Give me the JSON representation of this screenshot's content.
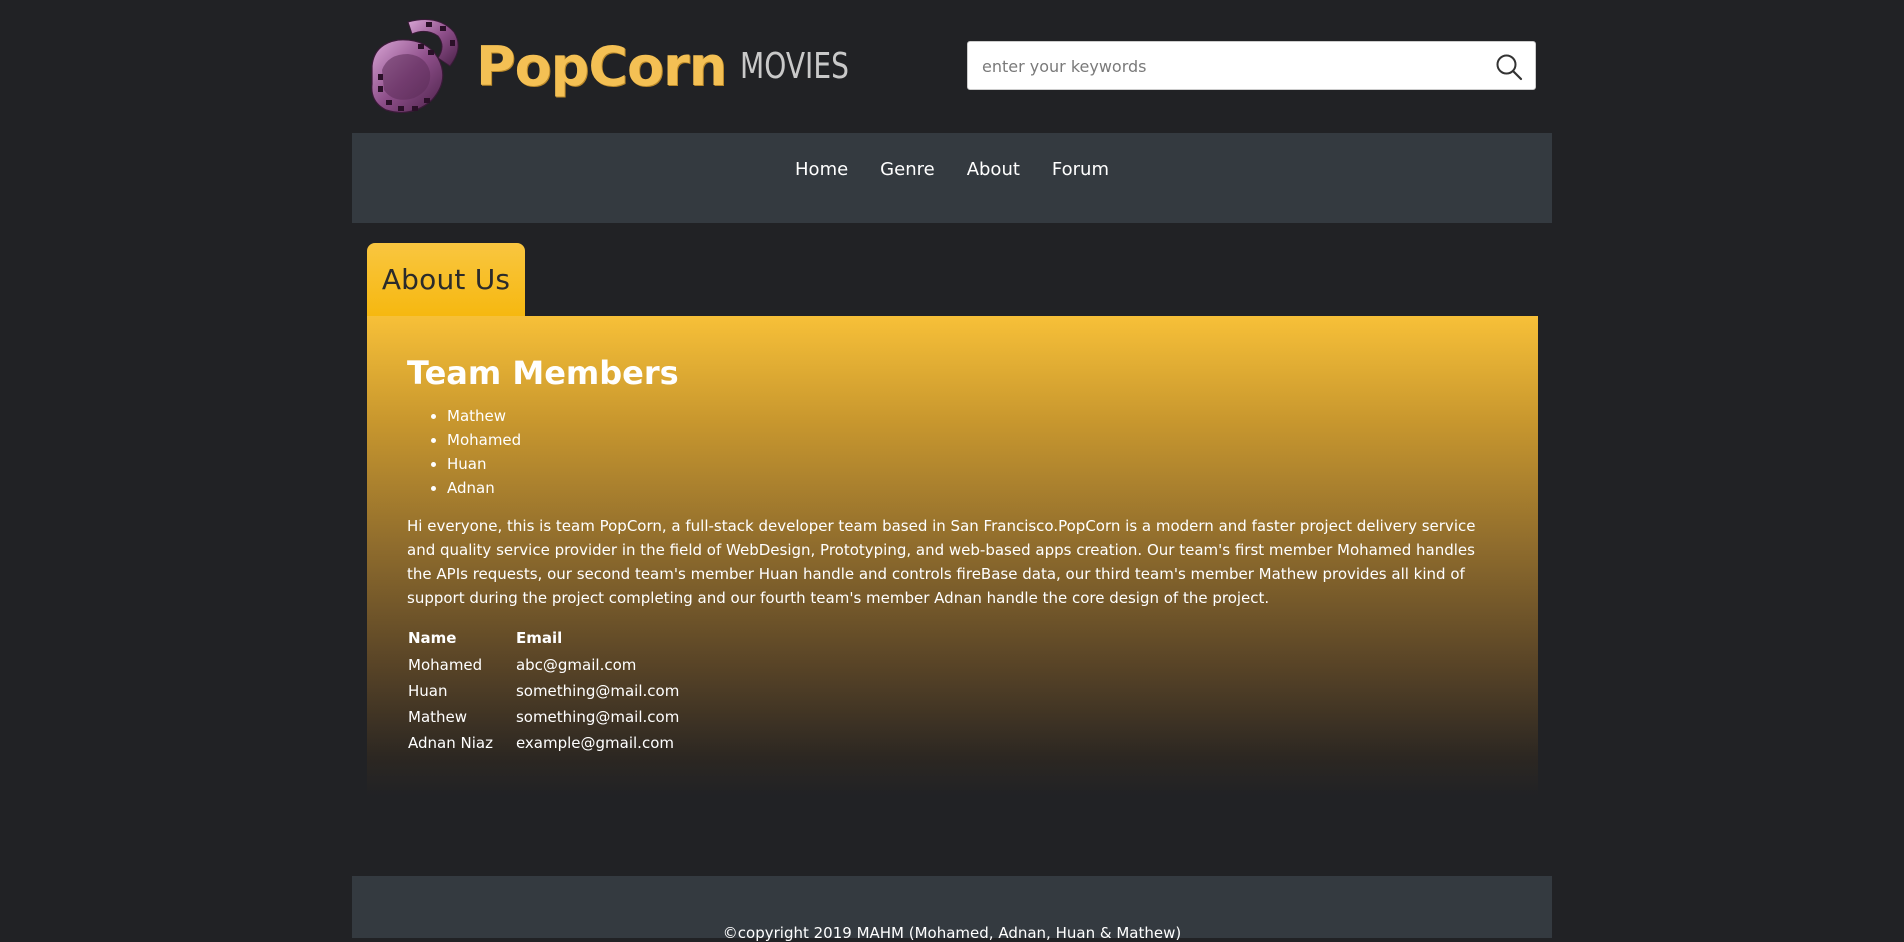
{
  "header": {
    "logo_primary": "PopCorn",
    "logo_secondary": "MOVIES",
    "search_placeholder": "enter your keywords",
    "search_icon": "search-icon"
  },
  "nav": {
    "items": [
      {
        "label": "Home"
      },
      {
        "label": "Genre"
      },
      {
        "label": "About"
      },
      {
        "label": "Forum"
      }
    ]
  },
  "about": {
    "tab_label": "About Us",
    "title": "Team Members",
    "members": [
      "Mathew",
      "Mohamed",
      "Huan",
      "Adnan"
    ],
    "description": "Hi everyone, this is team PopCorn, a full-stack developer team based in San Francisco.PopCorn is a modern and faster project delivery service and quality service provider in the field of WebDesign, Prototyping, and web-based apps creation. Our team's first member Mohamed handles the APIs requests, our second team's member Huan handle and controls fireBase data, our third team's member Mathew provides all kind of support during the project completing and our fourth team's member Adnan handle the core design of the project.",
    "table": {
      "headers": [
        "Name",
        "Email"
      ],
      "rows": [
        [
          "Mohamed",
          "abc@gmail.com"
        ],
        [
          "Huan",
          "something@mail.com"
        ],
        [
          "Mathew",
          "something@mail.com"
        ],
        [
          "Adnan Niaz",
          "example@gmail.com"
        ]
      ]
    }
  },
  "footer": {
    "copyright": "©copyright 2019 MAHM (Mohamed, Adnan, Huan & Mathew)"
  },
  "colors": {
    "background": "#212225",
    "nav_bg": "#343a40",
    "accent": "#f6b810",
    "logo_text": "#f4c054"
  }
}
